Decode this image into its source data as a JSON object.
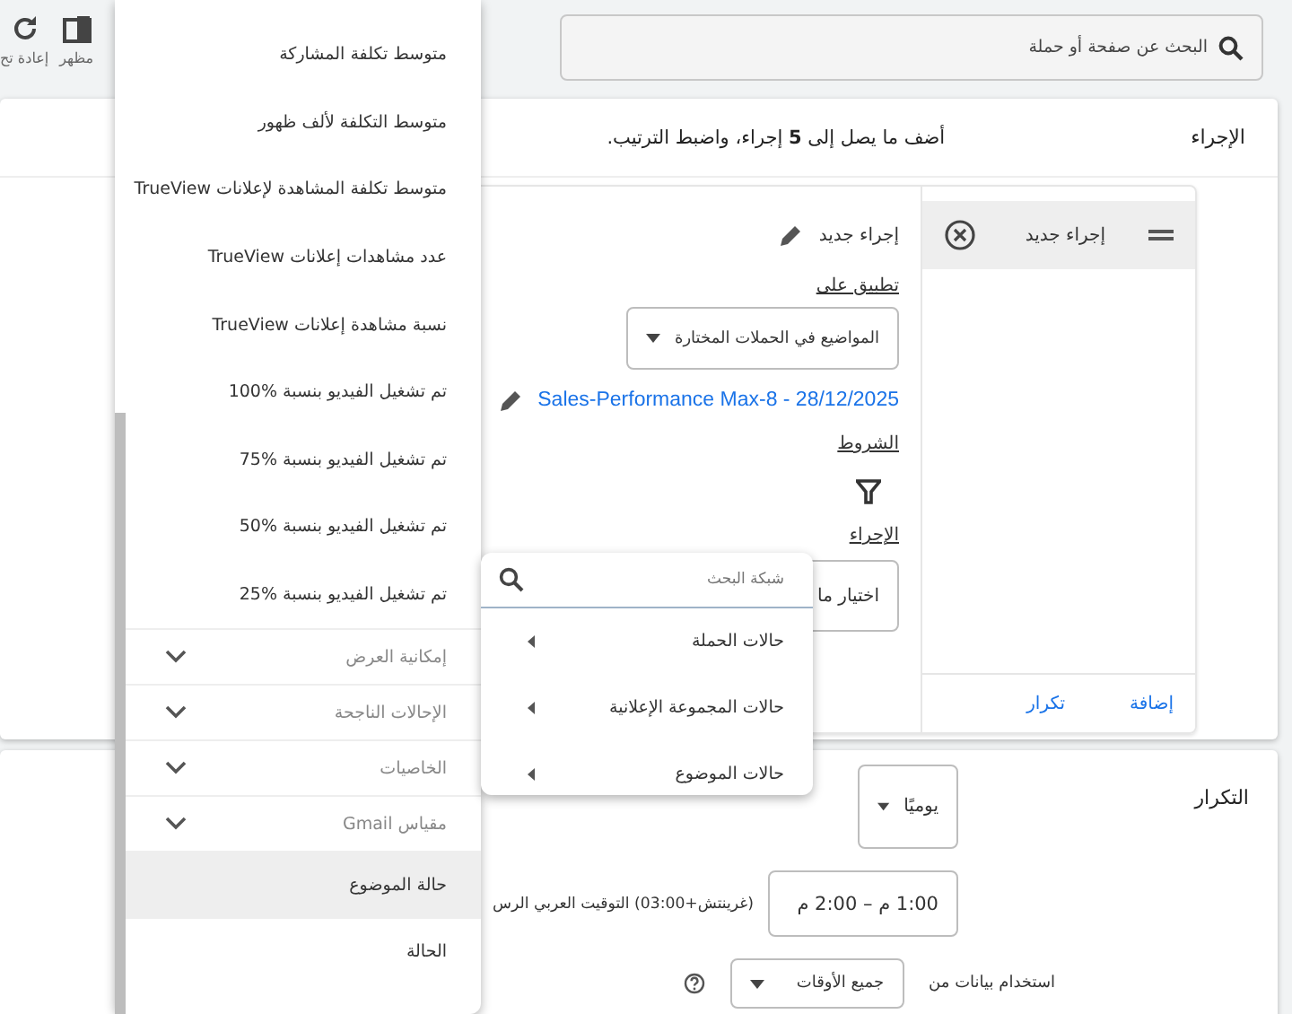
{
  "toolbar": [
    {
      "label": "مظهر"
    },
    {
      "label": "إعادة تح"
    }
  ],
  "search": {
    "placeholder": "البحث عن صفحة أو حملة"
  },
  "actions_card": {
    "title": "الإجراء",
    "hint": "أضف ما يصل إلى **5** إجراء، واضبط الترتيب.",
    "list": [
      {
        "label": "إجراء جديد",
        "selected": true
      }
    ],
    "footer_links": [
      "إضافة",
      "تكرار"
    ],
    "detail": {
      "name": "إجراء جديد",
      "apply_label": "تطبيق على",
      "apply_value": "المواضيع في الحملات المختارة",
      "campaign_link": "Sales-Performance Max-8 - 28/12/2025",
      "conditions_label": "الشروط",
      "action_label": "الإجراء",
      "action_value": "اختيار ما"
    }
  },
  "frequency_card": {
    "title": "التكرار",
    "frequency": "يوميًا",
    "time": "1:00 م – 2:00 م",
    "timezone": "(غرينتش+03:00) التوقيت العربي الرس",
    "data_label": "استخدام بيانات من",
    "data_range": "جميع الأوقات"
  },
  "metrics_menu": {
    "items": [
      {
        "kind": "option",
        "label": "متوسط تكلفة المشاركة",
        "selected": false
      },
      {
        "kind": "option",
        "label": "متوسط التكلفة لألف ظهور",
        "selected": false
      },
      {
        "kind": "option",
        "label": "متوسط تكلفة المشاهدة لإعلانات TrueView",
        "selected": false
      },
      {
        "kind": "option",
        "label": "عدد مشاهدات إعلانات TrueView",
        "selected": false
      },
      {
        "kind": "option",
        "label": "نسبة مشاهدة إعلانات TrueView",
        "selected": false
      },
      {
        "kind": "option",
        "label": "تم تشغيل الفيديو بنسبة %100",
        "selected": false
      },
      {
        "kind": "option",
        "label": "تم تشغيل الفيديو بنسبة %75",
        "selected": false
      },
      {
        "kind": "option",
        "label": "تم تشغيل الفيديو بنسبة %50",
        "selected": false
      },
      {
        "kind": "option",
        "label": "تم تشغيل الفيديو بنسبة %25",
        "selected": false
      },
      {
        "kind": "section",
        "label": "إمكانية العرض",
        "expanded": false
      },
      {
        "kind": "section",
        "label": "الإحالات الناجحة",
        "expanded": false
      },
      {
        "kind": "section",
        "label": "الخاصيات",
        "expanded": false
      },
      {
        "kind": "section",
        "label": "مقياس Gmail",
        "expanded": false
      },
      {
        "kind": "option",
        "label": "حالة الموضوع",
        "selected": true
      },
      {
        "kind": "option",
        "label": "الحالة",
        "selected": false
      }
    ]
  },
  "filter_menu": {
    "placeholder": "شبكة البحث",
    "items": [
      "حالات الحملة",
      "حالات المجموعة الإعلانية",
      "حالات الموضوع"
    ]
  }
}
